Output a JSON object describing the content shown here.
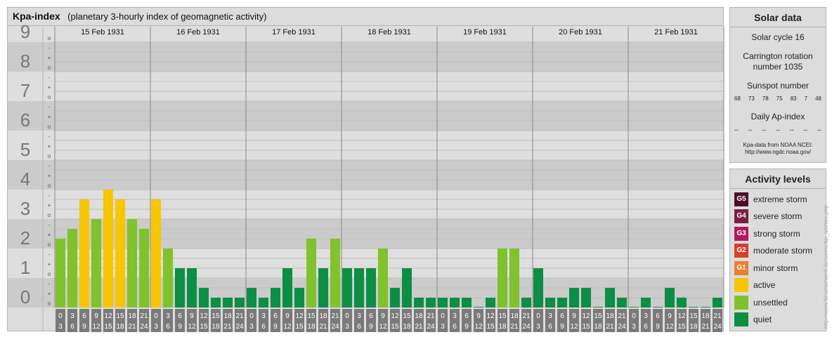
{
  "title": "Kpa-index",
  "subtitle": "(planetary 3-hourly index of geomagnetic activity)",
  "colors": {
    "quiet": "#0c8e45",
    "unsettled": "#80c12c",
    "active": "#f7c600",
    "g1": "#ea7f2f",
    "g2": "#d4402a",
    "g3": "#b3195f",
    "g4": "#7b1d45",
    "g5": "#4e0b28"
  },
  "chart_data": {
    "type": "bar",
    "title": "Kpa-index",
    "ylim": [
      0,
      9
    ],
    "y_ticks": [
      "0",
      "1",
      "2",
      "3",
      "4",
      "5",
      "6",
      "7",
      "8",
      "9"
    ],
    "sub_ticks": [
      "o",
      "-",
      "+"
    ],
    "days": [
      "15 Feb 1931",
      "16 Feb 1931",
      "17 Feb 1931",
      "18 Feb 1931",
      "19 Feb 1931",
      "20 Feb 1931",
      "21 Feb 1931"
    ],
    "interval_labels": [
      [
        "0",
        "3"
      ],
      [
        "3",
        "6"
      ],
      [
        "6",
        "9"
      ],
      [
        "9",
        "12"
      ],
      [
        "12",
        "15"
      ],
      [
        "15",
        "18"
      ],
      [
        "18",
        "21"
      ],
      [
        "21",
        "24"
      ]
    ],
    "values": [
      [
        2.333,
        2.667,
        3.667,
        3.0,
        4.0,
        3.667,
        3.0,
        2.667
      ],
      [
        3.667,
        2.0,
        1.333,
        1.333,
        0.667,
        0.333,
        0.333,
        0.333
      ],
      [
        0.667,
        0.333,
        0.667,
        1.333,
        0.667,
        2.333,
        1.333,
        2.333
      ],
      [
        1.333,
        1.333,
        1.333,
        2.0,
        0.667,
        1.333,
        0.333,
        0.333
      ],
      [
        0.333,
        0.333,
        0.333,
        0.0,
        0.333,
        2.0,
        2.0,
        0.333
      ],
      [
        1.333,
        0.333,
        0.333,
        0.667,
        0.667,
        0.0,
        0.667,
        0.333
      ],
      [
        0.0,
        0.333,
        0.0,
        0.667,
        0.333,
        0.0,
        0.0,
        0.333
      ]
    ]
  },
  "solar": {
    "heading": "Solar data",
    "solar_cycle": "Solar cycle 16",
    "carrington": "Carrington rotation number 1035",
    "sunspot_heading": "Sunspot number",
    "sunspot_values": [
      "68",
      "73",
      "78",
      "75",
      "83",
      "7",
      "48"
    ],
    "ap_heading": "Daily Ap-index",
    "ap_values": [
      "--",
      "--",
      "--",
      "--",
      "--",
      "--",
      "--"
    ],
    "source_line1": "Kpa-data from NOAA NCEI:",
    "source_line2": "http://www.ngdc.noaa.gov/"
  },
  "levels": {
    "heading": "Activity levels",
    "items": [
      {
        "badge": "G5",
        "label": "extreme storm",
        "color": "#4e0b28"
      },
      {
        "badge": "G4",
        "label": "severe storm",
        "color": "#7b1d45"
      },
      {
        "badge": "G3",
        "label": "strong storm",
        "color": "#b3195f"
      },
      {
        "badge": "G2",
        "label": "moderate storm",
        "color": "#d4402a"
      },
      {
        "badge": "G1",
        "label": "minor storm",
        "color": "#ea7f2f"
      },
      {
        "badge": "",
        "label": "active",
        "color": "#f7c600"
      },
      {
        "badge": "",
        "label": "unsettled",
        "color": "#80c12c"
      },
      {
        "badge": "",
        "label": "quiet",
        "color": "#0c8e45"
      }
    ]
  },
  "watermark": "http://www.fieselschweif.de/sonne/kp_archive.php"
}
